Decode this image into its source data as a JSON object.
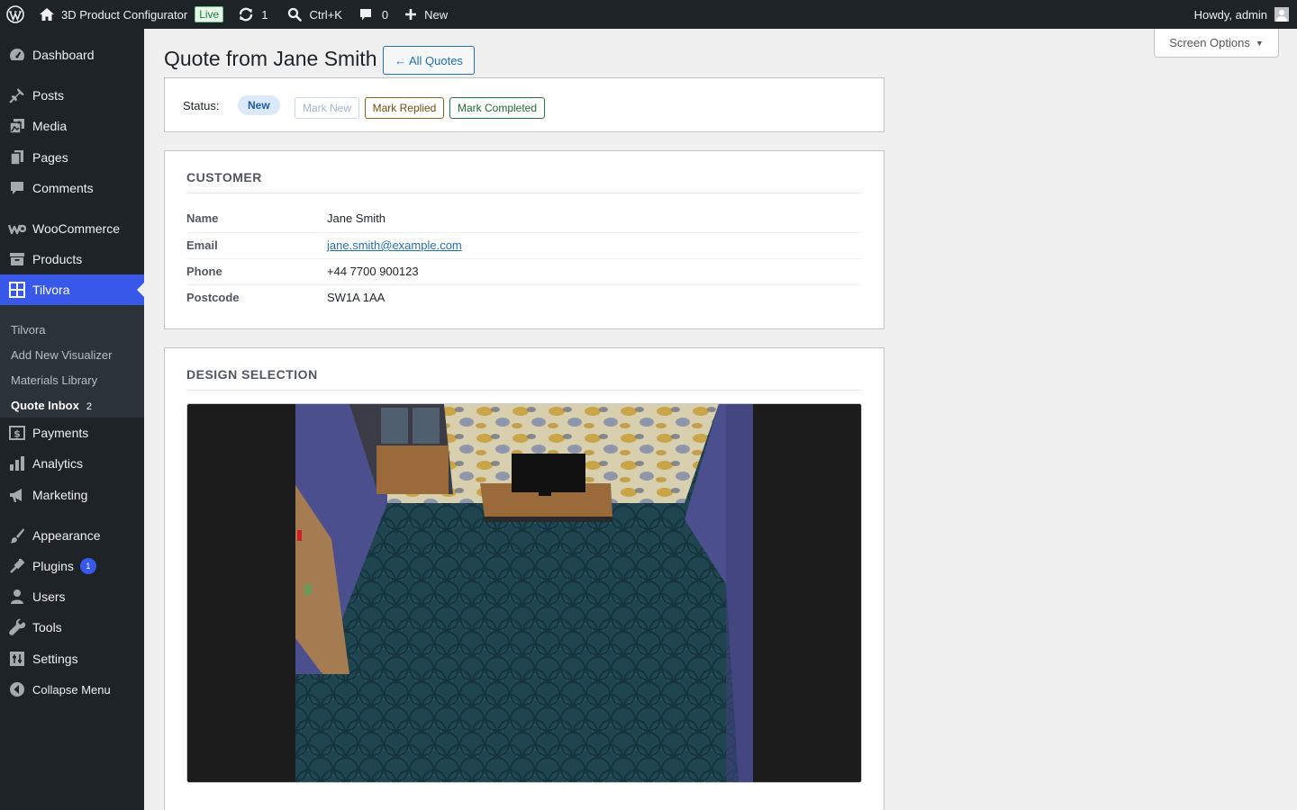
{
  "adminbar": {
    "site_name": "3D Product Configurator",
    "live_badge": "Live",
    "updates_count": "1",
    "search_shortcut": "Ctrl+K",
    "comments_count": "0",
    "new_label": "New",
    "howdy": "Howdy, admin"
  },
  "sidebar": {
    "items": [
      {
        "label": "Dashboard",
        "icon": "dashboard-icon"
      },
      {
        "label": "Posts",
        "icon": "pin-icon"
      },
      {
        "label": "Media",
        "icon": "media-icon"
      },
      {
        "label": "Pages",
        "icon": "pages-icon"
      },
      {
        "label": "Comments",
        "icon": "comment-icon"
      },
      {
        "label": "WooCommerce",
        "icon": "woocommerce-icon"
      },
      {
        "label": "Products",
        "icon": "archive-icon"
      },
      {
        "label": "Tilvora",
        "icon": "grid-icon"
      },
      {
        "label": "Payments",
        "icon": "payments-icon"
      },
      {
        "label": "Analytics",
        "icon": "chart-bar-icon"
      },
      {
        "label": "Marketing",
        "icon": "megaphone-icon"
      },
      {
        "label": "Appearance",
        "icon": "brush-icon"
      },
      {
        "label": "Plugins",
        "icon": "plug-icon",
        "badge": "1"
      },
      {
        "label": "Users",
        "icon": "user-icon"
      },
      {
        "label": "Tools",
        "icon": "wrench-icon"
      },
      {
        "label": "Settings",
        "icon": "settings-icon"
      },
      {
        "label": "Collapse Menu",
        "icon": "collapse-icon"
      }
    ],
    "submenu": [
      {
        "label": "Tilvora"
      },
      {
        "label": "Add New Visualizer"
      },
      {
        "label": "Materials Library"
      },
      {
        "label": "Quote Inbox",
        "count": "2"
      }
    ]
  },
  "screen_options": "Screen Options",
  "page": {
    "title": "Quote from Jane Smith",
    "back_label": "← All Quotes"
  },
  "status": {
    "label": "Status:",
    "current": "New",
    "buttons": [
      "Mark New",
      "Mark Replied",
      "Mark Completed"
    ]
  },
  "customer": {
    "title": "CUSTOMER",
    "rows": [
      {
        "label": "Name",
        "value": "Jane Smith"
      },
      {
        "label": "Email",
        "value": "jane.smith@example.com"
      },
      {
        "label": "Phone",
        "value": "+44 7700 900123"
      },
      {
        "label": "Postcode",
        "value": "SW1A 1AA"
      }
    ]
  },
  "design": {
    "title": "DESIGN SELECTION"
  },
  "colors": {
    "adminbar_bg": "#1d2327",
    "accent": "#3858e9",
    "link": "#2271b1"
  }
}
